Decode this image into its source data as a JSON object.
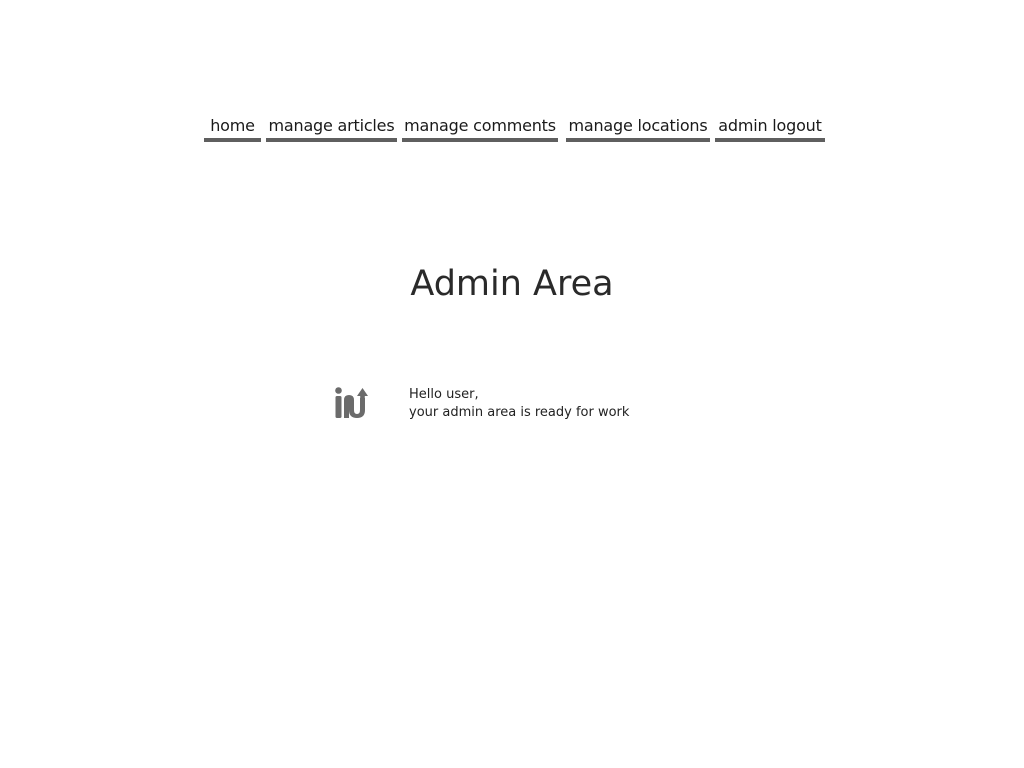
{
  "nav": {
    "items": [
      {
        "label": "home"
      },
      {
        "label": "manage articles"
      },
      {
        "label": "manage comments"
      },
      {
        "label": "manage locations"
      },
      {
        "label": "admin logout"
      }
    ]
  },
  "main": {
    "title": "Admin Area",
    "logo_icon": "in-logo-icon",
    "greeting_line1": "Hello user,",
    "greeting_line2": "your admin area is ready for work"
  },
  "colors": {
    "nav_underline": "#5f5f5f",
    "logo": "#6b6b6b",
    "text": "#222222"
  }
}
